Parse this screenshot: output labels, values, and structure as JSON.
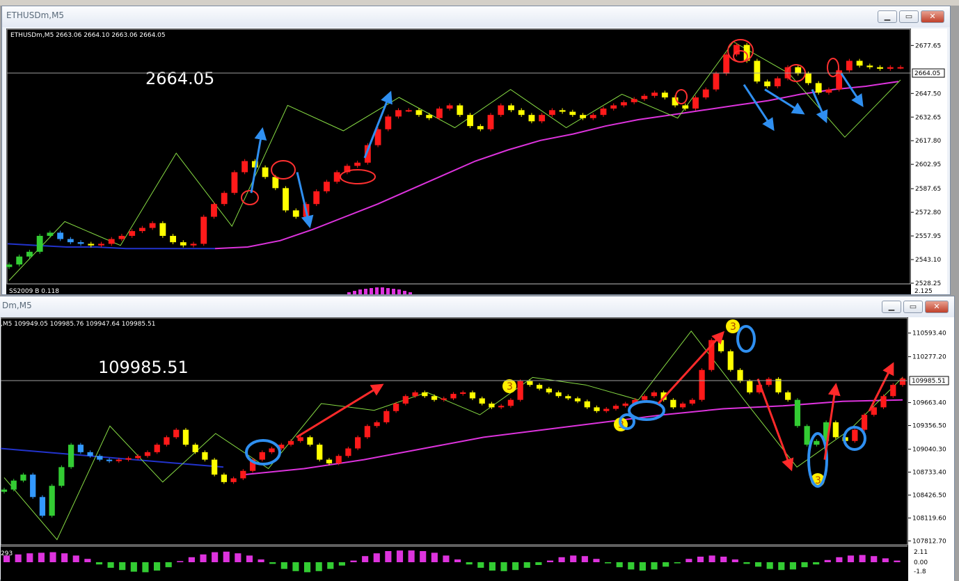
{
  "colors": {
    "bull": "#ff1a1a",
    "bear": "#ffff00",
    "bull_low": "#33cc33",
    "bear_low": "#3399ff",
    "ma_fast": "#2233cc",
    "ma_slow": "#dd33dd",
    "zigzag": "#88dd44",
    "arrow_red": "#ff2a2a",
    "arrow_blue": "#2f8ff0",
    "circle_red": "#ff3030",
    "circle_blue": "#2f8ff0",
    "osc": "#dd33dd",
    "osc_neg": "#33cc33"
  },
  "window1": {
    "title": "ETHUSDm,M5",
    "buttons": [
      "minimize",
      "restore",
      "close"
    ],
    "info": "ETHUSDm,M5  2663.06 2664.10 2663.06 2664.05",
    "big_price": "2664.05",
    "current_price_label": "2664.05",
    "indicator_label": "SS2009  B 0.118",
    "indicator_value": "2.125",
    "chart_data": {
      "type": "line",
      "title": "ETHUSDm,M5",
      "yticks": [
        "2677.65",
        "2647.50",
        "2632.65",
        "2617.80",
        "2602.95",
        "2587.65",
        "2572.80",
        "2557.95",
        "2543.10",
        "2528.25"
      ],
      "ylim": [
        2528.25,
        2684.8
      ],
      "current_price": 2664.05,
      "close": [
        2540,
        2545,
        2548,
        2558,
        2560,
        2556,
        2554,
        2553,
        2552,
        2553,
        2556,
        2558,
        2561,
        2563,
        2566,
        2558,
        2554,
        2552,
        2553,
        2570,
        2578,
        2585,
        2598,
        2605,
        2601,
        2595,
        2588,
        2574,
        2570,
        2578,
        2586,
        2592,
        2598,
        2602,
        2604,
        2615,
        2625,
        2633,
        2637,
        2637,
        2634,
        2632,
        2638,
        2640,
        2634,
        2627,
        2625,
        2634,
        2640,
        2637,
        2634,
        2630,
        2634,
        2637,
        2636,
        2634,
        2632,
        2634,
        2638,
        2640,
        2642,
        2644,
        2646,
        2648,
        2645,
        2640,
        2638,
        2645,
        2650,
        2660,
        2672,
        2678,
        2668,
        2655,
        2652,
        2657,
        2664,
        2660,
        2654,
        2648,
        2650,
        2662,
        2668,
        2665,
        2664,
        2663,
        2664,
        2664
      ],
      "ma_fast": [
        2553,
        2552,
        2551,
        2551,
        2550,
        2550,
        2550,
        2550
      ],
      "ma_slow": [
        2550,
        2551,
        2555,
        2562,
        2570,
        2578,
        2587,
        2596,
        2605,
        2612,
        2618,
        2622,
        2627,
        2631,
        2634,
        2637,
        2640,
        2643,
        2647,
        2650,
        2652,
        2655
      ],
      "zigzag": [
        2530,
        2567,
        2552,
        2610,
        2564,
        2640,
        2624,
        2645,
        2626,
        2650,
        2626,
        2647,
        2632,
        2680,
        2660,
        2620,
        2656
      ],
      "arrows": [
        {
          "color": "blue",
          "direction": "up",
          "from": 2585,
          "to": 2625
        },
        {
          "color": "blue",
          "direction": "down",
          "from": 2598,
          "to": 2564
        },
        {
          "color": "blue",
          "direction": "up",
          "from": 2607,
          "to": 2648
        },
        {
          "color": "blue",
          "direction": "down",
          "from": 2653,
          "to": 2625
        },
        {
          "color": "blue",
          "direction": "down",
          "from": 2650,
          "to": 2635
        },
        {
          "color": "blue",
          "direction": "down",
          "from": 2650,
          "to": 2630
        },
        {
          "color": "blue",
          "direction": "down",
          "from": 2660,
          "to": 2640
        }
      ],
      "circles": {
        "color": "red",
        "count": 8
      }
    }
  },
  "window2": {
    "title": "Dm,M5",
    "buttons": [
      "minimize",
      "restore",
      "close"
    ],
    "info": ",M5  109949.05 109985.76 109947.64 109985.51",
    "big_price": "109985.51",
    "current_price_label": "109985.51",
    "osc_left_value": "293",
    "osc_ticks": [
      "2.11",
      "0.00",
      "-1.8"
    ],
    "chart_data": {
      "type": "line",
      "yticks": [
        "110593.40",
        "110277.20",
        "109663.40",
        "109356.50",
        "109040.30",
        "108733.40",
        "108426.50",
        "108119.60",
        "107812.70"
      ],
      "ylim": [
        107770,
        110730
      ],
      "current_price": 109985.51,
      "close": [
        108500,
        108620,
        108700,
        108400,
        108150,
        108550,
        108800,
        109100,
        109000,
        108950,
        108900,
        108880,
        108900,
        108920,
        108950,
        109000,
        109100,
        109200,
        109300,
        109100,
        109000,
        108900,
        108700,
        108600,
        108650,
        108750,
        108900,
        109000,
        109050,
        109100,
        109150,
        109200,
        109100,
        108900,
        108850,
        108950,
        109050,
        109200,
        109350,
        109400,
        109550,
        109650,
        109750,
        109800,
        109750,
        109700,
        109720,
        109780,
        109800,
        109720,
        109650,
        109600,
        109620,
        109700,
        109950,
        109900,
        109850,
        109800,
        109750,
        109720,
        109680,
        109600,
        109550,
        109580,
        109620,
        109650,
        109700,
        109750,
        109800,
        109700,
        109600,
        109650,
        109700,
        110100,
        110500,
        110350,
        110100,
        109950,
        109800,
        109900,
        109980,
        109800,
        109700,
        109350,
        109100,
        109150,
        109400,
        109200,
        109150,
        109300,
        109500,
        109600,
        109750,
        109900,
        109985
      ],
      "ma_fast": [
        109050,
        109000,
        108950,
        108900,
        108850,
        108800
      ],
      "ma_slow": [
        108700,
        108780,
        108900,
        109050,
        109200,
        109300,
        109400,
        109500,
        109580,
        109620,
        109680,
        109700
      ],
      "zigzag": [
        108660,
        107830,
        109350,
        108600,
        109250,
        108780,
        109650,
        109560,
        109800,
        109500,
        110000,
        109900,
        109700,
        110620,
        109700,
        108800,
        109300,
        110000
      ],
      "arrows": [
        {
          "color": "red",
          "direction": "up",
          "from": 109200,
          "to": 109900
        },
        {
          "color": "red",
          "direction": "up",
          "from": 109650,
          "to": 110600
        },
        {
          "color": "red",
          "direction": "down",
          "from": 109980,
          "to": 108770
        },
        {
          "color": "red",
          "direction": "up",
          "from": 108900,
          "to": 109900
        },
        {
          "color": "red",
          "direction": "up",
          "from": 109550,
          "to": 110180
        }
      ],
      "circles": {
        "color": "blue",
        "count": 6
      },
      "markers": [
        "3",
        "3",
        "3",
        "3"
      ],
      "oscillator": [
        1.2,
        1.4,
        1.6,
        1.7,
        1.8,
        1.6,
        1.2,
        0.6,
        -0.4,
        -1.0,
        -1.4,
        -1.7,
        -1.8,
        -1.5,
        -0.9,
        0.2,
        0.9,
        1.4,
        1.8,
        1.9,
        1.6,
        1.2,
        0.5,
        -0.3,
        -1.2,
        -1.6,
        -1.8,
        -1.6,
        -1.2,
        -0.6,
        0.3,
        1.1,
        1.6,
        2.0,
        2.1,
        2.11,
        2.0,
        1.7,
        1.2,
        0.5,
        -0.4,
        -1.0,
        -1.5,
        -1.6,
        -1.4,
        -1.0,
        -0.5,
        0.3,
        0.9,
        1.2,
        1.1,
        0.6,
        -0.2,
        -0.9,
        -1.3,
        -1.5,
        -1.3,
        -0.8,
        -0.2,
        0.6,
        1.0,
        1.2,
        1.0,
        0.5,
        -0.3,
        -0.8,
        -1.2,
        -1.4,
        -1.3,
        -0.9,
        -0.4,
        0.4,
        0.9,
        1.2,
        1.3,
        1.1,
        0.7,
        0.3
      ]
    }
  }
}
